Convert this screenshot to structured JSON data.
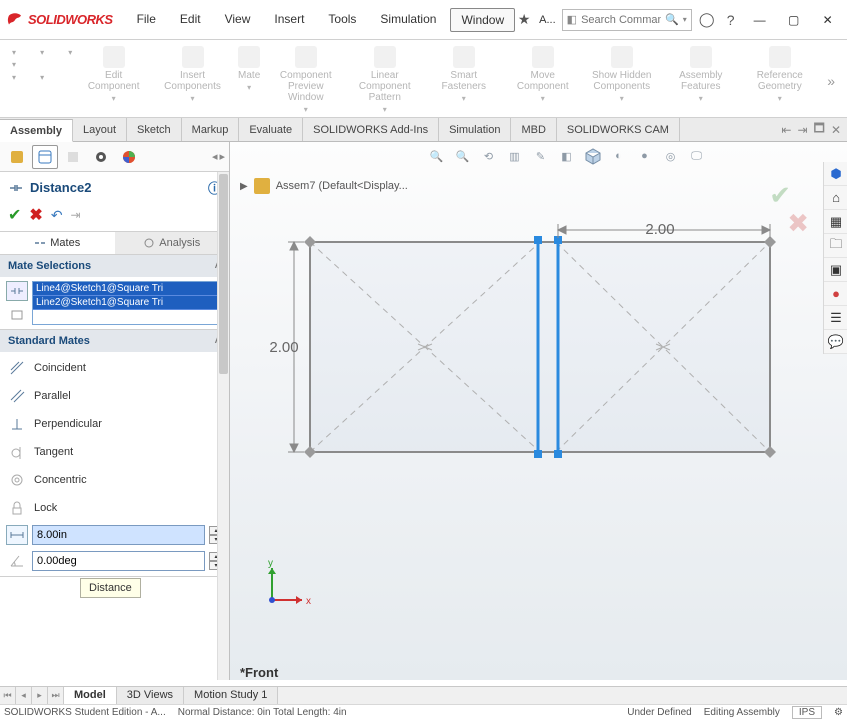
{
  "app": {
    "logo_text": "SOLIDWORKS"
  },
  "menu": {
    "items": [
      "File",
      "Edit",
      "View",
      "Insert",
      "Tools",
      "Simulation",
      "Window"
    ],
    "active": 6
  },
  "title_right": {
    "star_label": "A...",
    "search_placeholder": "Search Comman"
  },
  "ribbon": {
    "groups": [
      "Edit Component",
      "Insert Components",
      "Mate",
      "Component Preview Window",
      "Linear Component Pattern",
      "Smart Fasteners",
      "Move Component",
      "Show Hidden Components",
      "Assembly Features",
      "Reference Geometry"
    ]
  },
  "tabs": [
    "Assembly",
    "Layout",
    "Sketch",
    "Markup",
    "Evaluate",
    "SOLIDWORKS Add-Ins",
    "Simulation",
    "MBD",
    "SOLIDWORKS CAM"
  ],
  "tabs_active": 0,
  "pm": {
    "title": "Distance2",
    "mate_tabs": {
      "mates": "Mates",
      "analysis": "Analysis"
    },
    "mate_selections_hdr": "Mate Selections",
    "selections": [
      "Line4@Sketch1@Square Tri",
      "Line2@Sketch1@Square Tri"
    ],
    "std_mates_hdr": "Standard Mates",
    "mates": {
      "coincident": "Coincident",
      "parallel": "Parallel",
      "perpendicular": "Perpendicular",
      "tangent": "Tangent",
      "concentric": "Concentric",
      "lock": "Lock"
    },
    "distance_value": "8.00in",
    "angle_value": "0.00deg",
    "distance_tooltip": "Distance"
  },
  "viewport": {
    "assem_label": "Assem7  (Default<Display...",
    "dim_h": "2.00",
    "dim_v": "2.00",
    "view_name": "*Front",
    "triad": {
      "x": "x",
      "y": "y"
    }
  },
  "sheet_tabs": [
    "Model",
    "3D Views",
    "Motion Study 1"
  ],
  "sheet_active": 0,
  "status": {
    "left": "SOLIDWORKS Student Edition - A...",
    "mid": "Normal Distance: 0in Total Length: 4in",
    "state": "Under Defined",
    "mode": "Editing Assembly",
    "units": "IPS"
  }
}
